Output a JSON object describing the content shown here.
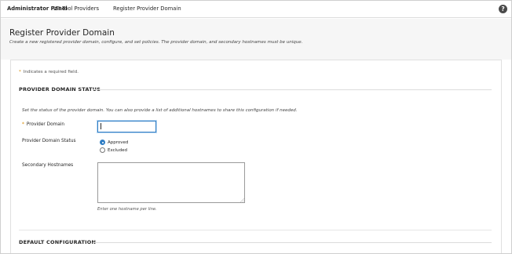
{
  "breadcrumb": {
    "items": [
      {
        "label": "Administrator Panel"
      },
      {
        "label": "LTI Tool Providers"
      },
      {
        "label": "Register Provider Domain"
      }
    ],
    "help_icon": "?"
  },
  "header": {
    "title": "Register Provider Domain",
    "description": "Create a new registered provider domain, configure, and set policies. The provider domain, and secondary hostnames must be unique."
  },
  "form": {
    "required_marker": "*",
    "required_note": "Indicates a required field.",
    "sections": [
      {
        "heading": "PROVIDER DOMAIN STATUS"
      },
      {
        "heading": "DEFAULT CONFIGURATION"
      }
    ],
    "section_description": "Set the status of the provider domain. You can also provide a list of additional hostnames to share this configuration if needed.",
    "provider_domain": {
      "label": "Provider Domain",
      "value": ""
    },
    "status": {
      "label": "Provider Domain Status",
      "options": [
        {
          "label": "Approved",
          "checked": true
        },
        {
          "label": "Excluded",
          "checked": false
        }
      ]
    },
    "secondary_hostnames": {
      "label": "Secondary Hostnames",
      "value": "",
      "hint": "Enter one hostname per line."
    }
  },
  "colors": {
    "accent": "#2f7dc4",
    "required": "#d88a00",
    "header_bg": "#f6f6f6"
  },
  "icons": {
    "help": "help-icon",
    "resize": "resize-grip-icon"
  }
}
